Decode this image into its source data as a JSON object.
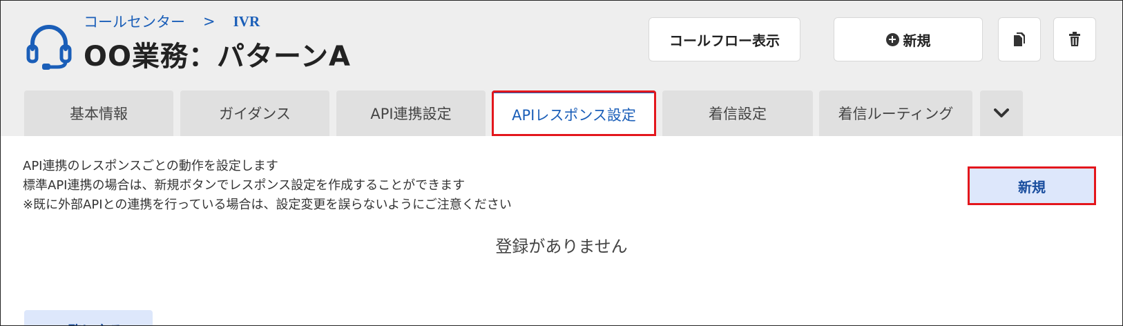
{
  "header": {
    "breadcrumb": [
      "コールセンター",
      "IVR"
    ],
    "breadcrumb_separator": ">",
    "title": "OO業務：パターンA",
    "buttons": {
      "callflow_label": "コールフロー表示",
      "new_label": "新規"
    },
    "icons": [
      "headset-icon",
      "plus-circle-icon",
      "copy-icon",
      "trash-icon"
    ]
  },
  "tabs": [
    {
      "label": "基本情報",
      "active": false
    },
    {
      "label": "ガイダンス",
      "active": false
    },
    {
      "label": "API連携設定",
      "active": false
    },
    {
      "label": "APIレスポンス設定",
      "active": true
    },
    {
      "label": "着信設定",
      "active": false
    },
    {
      "label": "着信ルーティング",
      "active": false
    }
  ],
  "tab_more_icon": "chevron-down-icon",
  "content": {
    "description": [
      "API連携のレスポンスごとの動作を設定します",
      "標準API連携の場合は、新規ボタンでレスポンス設定を作成することができます",
      "※既に外部APIとの連携を行っている場合は、設定変更を誤らないようにご注意ください"
    ],
    "new_button_label": "新規",
    "empty_message": "登録がありません",
    "back_button_label": "一覧に戻る"
  },
  "colors": {
    "accent": "#1a5eb8",
    "highlight": "#e3161c",
    "header_bg": "#eeeeee"
  }
}
